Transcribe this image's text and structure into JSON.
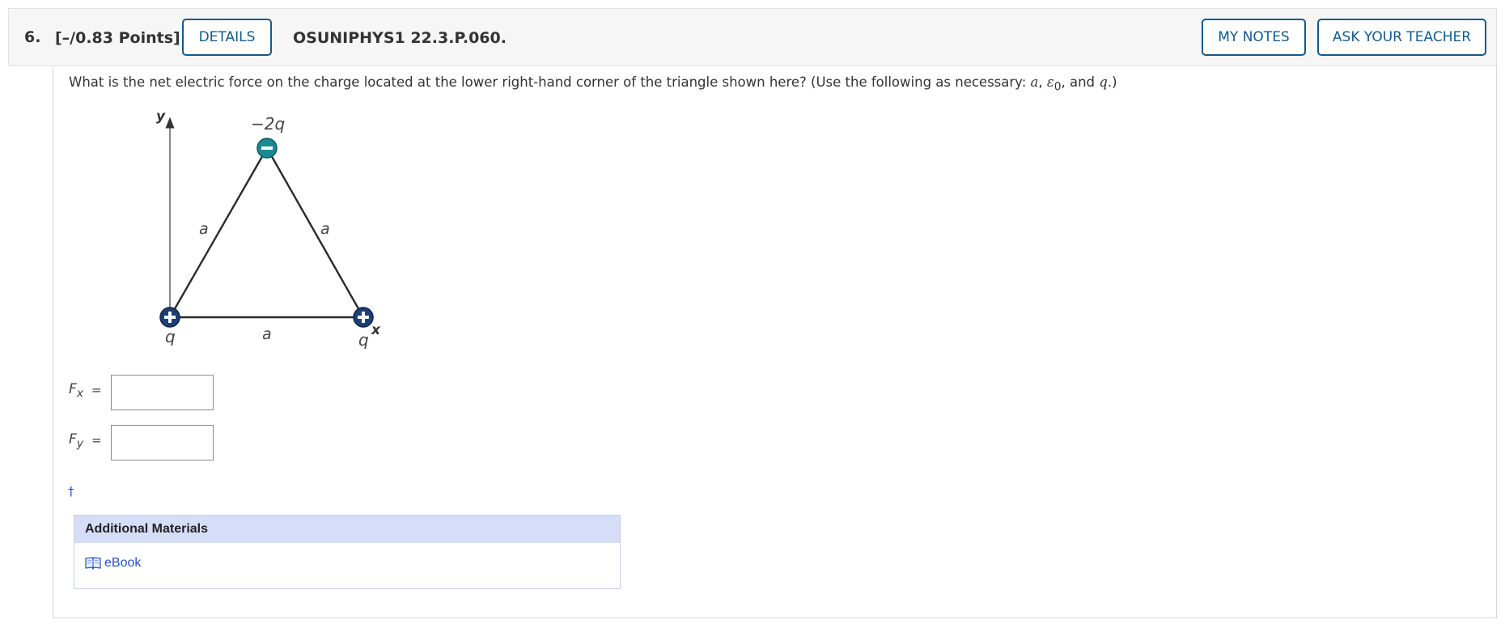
{
  "header": {
    "number": "6.",
    "points": "[–/0.83 Points]",
    "details_label": "DETAILS",
    "question_id": "OSUNIPHYS1 22.3.P.060.",
    "my_notes_label": "MY NOTES",
    "ask_teacher_label": "ASK YOUR TEACHER"
  },
  "question": {
    "prompt_before": "What is the net electric force on the charge located at the lower right-hand corner of the triangle shown here? (Use the following as necessary: ",
    "var_a": "a",
    "sep1": ", ",
    "var_eps": "ε",
    "eps_sub": "0",
    "sep2": ", and ",
    "var_q": "q",
    "prompt_after": ".)"
  },
  "figure": {
    "top_charge_label": "−2q",
    "left_charge_label": "q",
    "right_charge_label": "q",
    "side_left_label": "a",
    "side_right_label": "a",
    "side_bottom_label": "a",
    "y_axis_label": "y",
    "x_axis_label": "x"
  },
  "answers": [
    {
      "var": "F",
      "sub": "x",
      "eq": "=",
      "value": ""
    },
    {
      "var": "F",
      "sub": "y",
      "eq": "=",
      "value": ""
    }
  ],
  "footnote": "†",
  "materials": {
    "title": "Additional Materials",
    "ebook_label": "eBook"
  },
  "colors": {
    "button_border": "#135a8c",
    "header_bg": "#f6f6f6",
    "materials_head_bg": "#d6ddf7",
    "link": "#2a4fc6",
    "negative_charge": "#1a8a95",
    "positive_charge": "#1d3f73"
  }
}
